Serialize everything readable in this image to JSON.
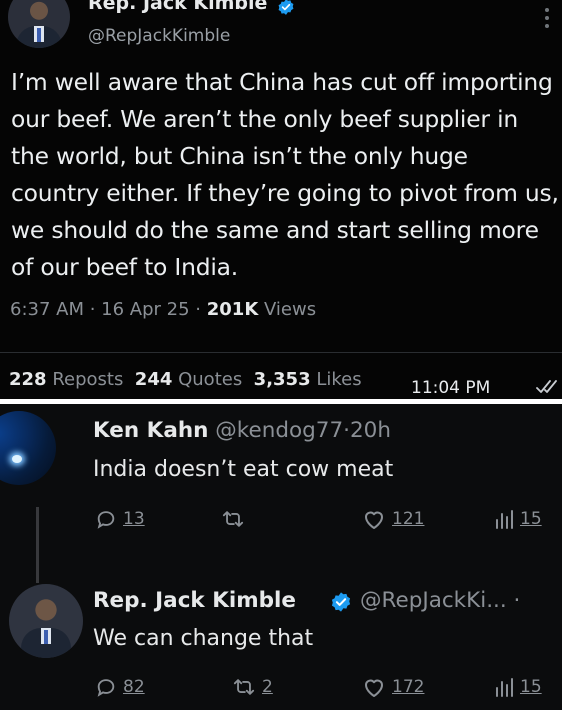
{
  "top_tweet": {
    "author_name": "Rep. Jack Kimble",
    "author_handle": "@RepJackKimble",
    "text": "I’m well aware that China has cut off importing our beef. We aren’t the only beef supplier in the world, but China isn’t the only huge country either. If they’re going to pivot from us, we should do the same and start selling more of our beef to India.",
    "time": "6:37 AM",
    "date": "16 Apr 25",
    "views_count": "201K",
    "views_label": "Views",
    "reposts_count": "228",
    "reposts_label": "Reposts",
    "quotes_count": "244",
    "quotes_label": "Quotes",
    "likes_count": "3,353",
    "likes_label": "Likes",
    "message_time": "11:04 PM"
  },
  "reply_1": {
    "author_name": "Ken Kahn",
    "author_handle": "@kendog77",
    "age": "20h",
    "text": "India doesn’t eat cow meat",
    "replies": "13",
    "reposts": "",
    "likes": "121",
    "views": "15"
  },
  "reply_2": {
    "author_name": "Rep. Jack Kimble",
    "author_handle": "@RepJackKi...",
    "text": "We can change that",
    "replies": "82",
    "reposts": "2",
    "likes": "172",
    "views": "15"
  },
  "colors": {
    "background_dark": "#050505",
    "text_primary": "#e7e9ea",
    "text_muted": "#8b9096",
    "verified_blue": "#1d9bf0"
  },
  "icons": [
    "verified-badge-icon",
    "more-icon",
    "double-check-icon",
    "reply-icon",
    "repost-icon",
    "like-icon",
    "views-icon"
  ]
}
